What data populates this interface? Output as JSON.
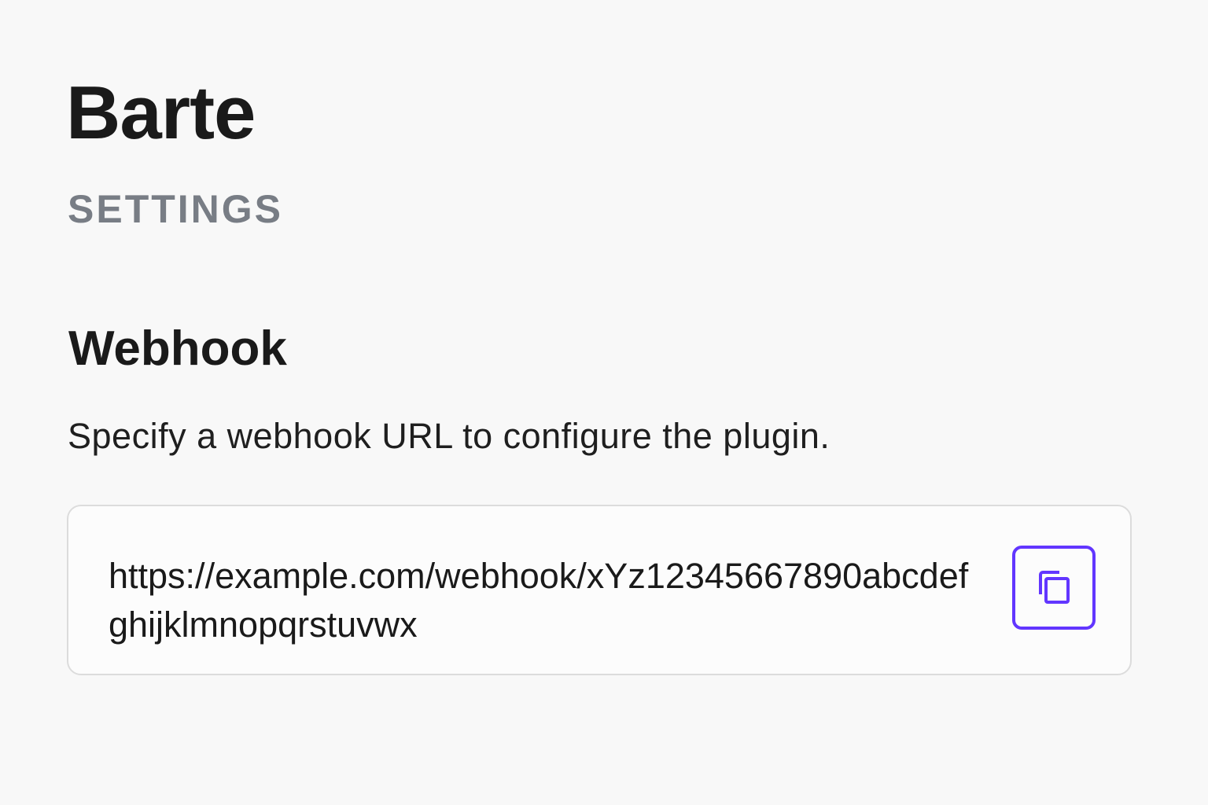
{
  "app": {
    "title": "Barte"
  },
  "page": {
    "section_label": "SETTINGS"
  },
  "webhook": {
    "heading": "Webhook",
    "description": "Specify a webhook URL to configure the plugin.",
    "url": "https://example.com/webhook/xYz12345667890abcdefghijklmnopqrstuvwx",
    "copy_icon": "copy-icon"
  },
  "colors": {
    "accent": "#6236ff",
    "muted_text": "#787d85",
    "border": "#dcdcdc",
    "background": "#f8f8f8"
  }
}
